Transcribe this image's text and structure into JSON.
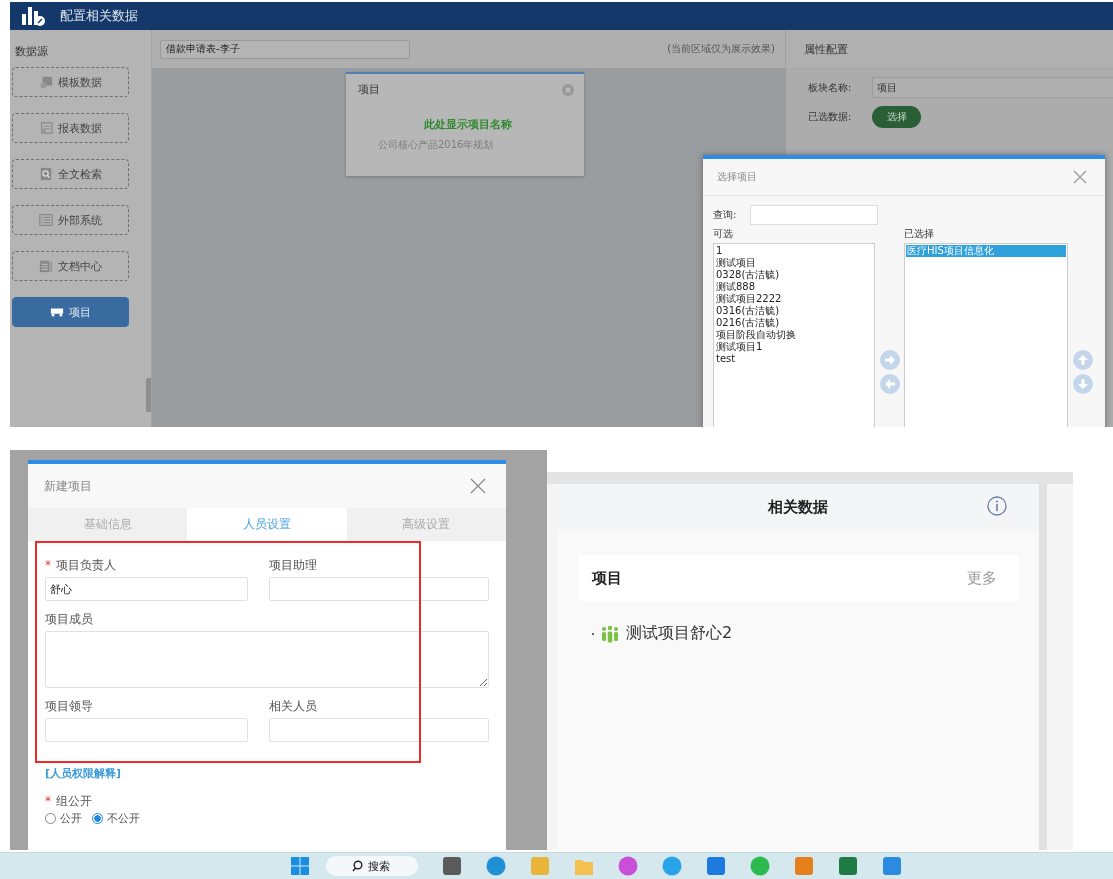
{
  "config_window": {
    "title": "配置相关数据",
    "sidebar_heading": "数据源",
    "sources": [
      {
        "label": "模板数据",
        "kind": "template",
        "selected": false
      },
      {
        "label": "报表数据",
        "kind": "report",
        "selected": false
      },
      {
        "label": "全文检索",
        "kind": "search",
        "selected": false
      },
      {
        "label": "外部系统",
        "kind": "external",
        "selected": false
      },
      {
        "label": "文档中心",
        "kind": "document",
        "selected": false
      },
      {
        "label": "项目",
        "kind": "project",
        "selected": true
      }
    ],
    "report_field": {
      "value": "借款申请表-李子"
    },
    "preview_note": "(当前区域仅为展示效果)",
    "preview_card": {
      "title": "项目",
      "hint": "此处显示项目名称",
      "faded_items": [
        "公司核心产品2016年规划"
      ]
    },
    "properties": {
      "title": "属性配置",
      "name_label": "板块名称:",
      "name_value": "项目",
      "data_label": "已选数据:",
      "choose_button": "选择"
    },
    "select_dialog": {
      "title": "选择项目",
      "query_label": "查询:",
      "available_label": "可选",
      "available": [
        "1",
        "测试项目",
        "0328(古洁毓)",
        "测试888",
        "测试项目2222",
        "0316(古洁毓)",
        "0216(古洁毓)",
        "项目阶段自动切换",
        "测试项目1",
        "test"
      ],
      "selected_label": "已选择",
      "chosen": [
        {
          "label": "医疗HIS项目信息化",
          "selected": true
        }
      ]
    }
  },
  "new_project_dialog": {
    "title": "新建项目",
    "tabs": [
      {
        "label": "基础信息",
        "selected": false
      },
      {
        "label": "人员设置",
        "selected": true
      },
      {
        "label": "高级设置",
        "selected": false
      }
    ],
    "fields": [
      {
        "label": "项目负责人",
        "required_mark": "*",
        "kind": "input",
        "value": "舒心"
      },
      {
        "label": "项目助理",
        "kind": "input"
      },
      {
        "label": "项目成员",
        "kind": "textarea"
      },
      {
        "label": "项目领导",
        "kind": "input"
      },
      {
        "label": "相关人员",
        "kind": "input"
      }
    ],
    "permission_link": "[人员权限解释]",
    "visibility": {
      "label": "组公开",
      "required_mark": "*",
      "options": [
        {
          "label": "公开",
          "selected": false
        },
        {
          "label": "不公开",
          "selected": true
        }
      ]
    }
  },
  "related_panel": {
    "title": "相关数据",
    "section_title": "项目",
    "more": "更多",
    "items": [
      {
        "label": "测试项目舒心2"
      }
    ]
  },
  "taskbar": {
    "search": "搜索"
  }
}
